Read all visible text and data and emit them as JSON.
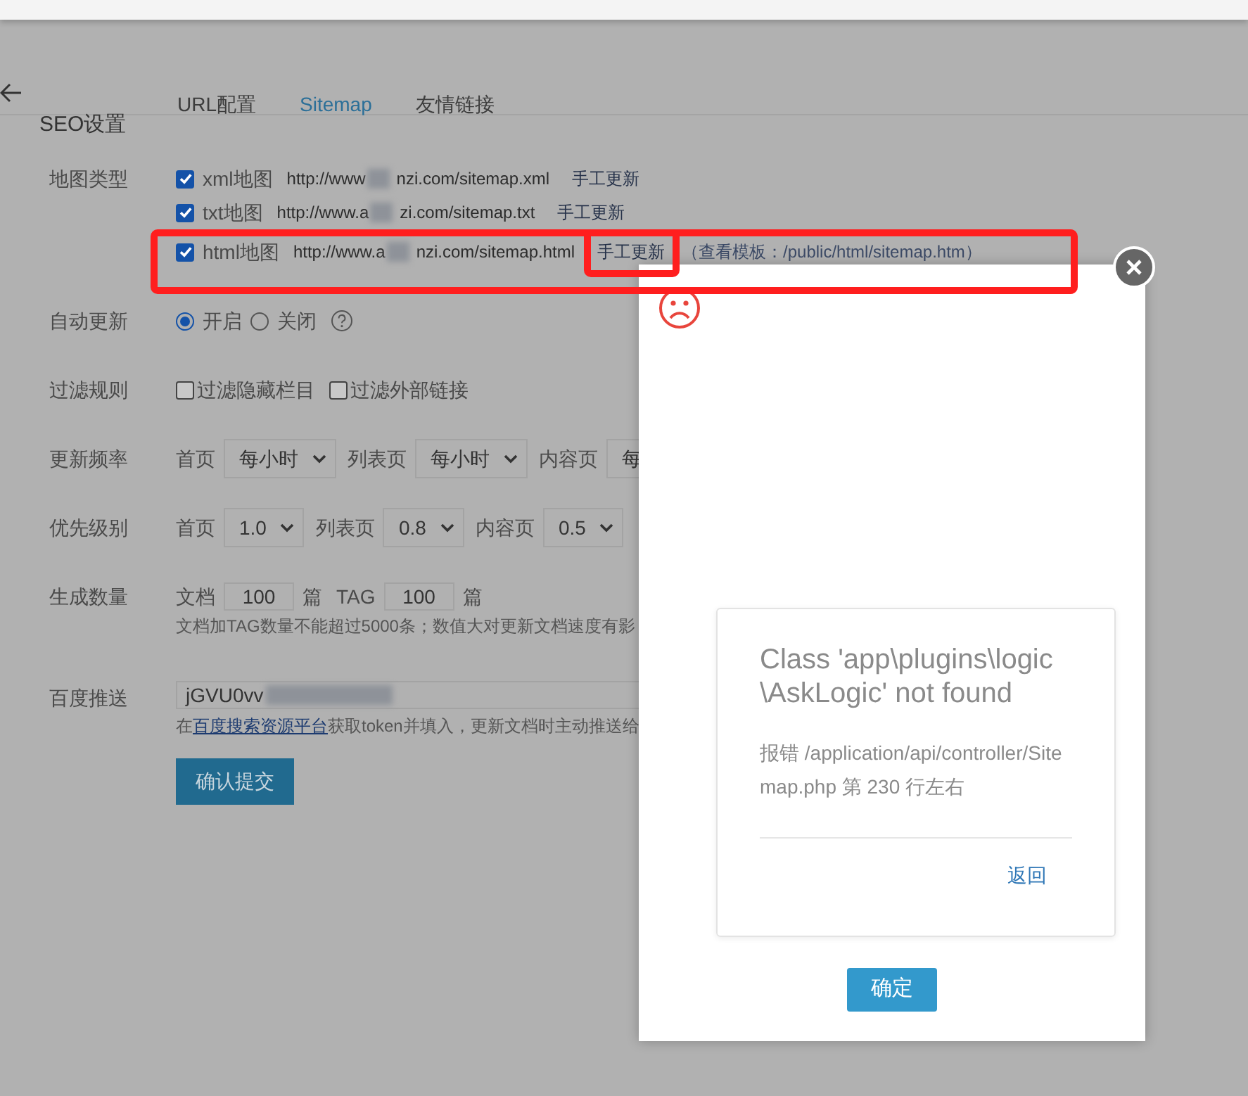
{
  "header": {
    "title": "SEO设置",
    "tabs": [
      {
        "label": "URL配置",
        "selected": false
      },
      {
        "label": "Sitemap",
        "selected": true
      },
      {
        "label": "友情链接",
        "selected": false
      }
    ]
  },
  "map_types": {
    "label": "地图类型",
    "items": [
      {
        "checked": true,
        "name": "xml地图",
        "url_start": "http://www",
        "url_end": "nzi.com/sitemap.xml",
        "action": "手工更新"
      },
      {
        "checked": true,
        "name": "txt地图",
        "url_start": "http://www.a",
        "url_end": "zi.com/sitemap.txt",
        "action": "手工更新"
      },
      {
        "checked": true,
        "name": "html地图",
        "url_start": "http://www.a",
        "url_end": "nzi.com/sitemap.html",
        "action": "手工更新",
        "note": "（查看模板：/public/html/sitemap.htm）"
      }
    ]
  },
  "auto_update": {
    "label": "自动更新",
    "options": [
      {
        "label": "开启",
        "selected": true
      },
      {
        "label": "关闭",
        "selected": false
      }
    ]
  },
  "filter": {
    "label": "过滤规则",
    "options": [
      {
        "label": "过滤隐藏栏目",
        "checked": false
      },
      {
        "label": "过滤外部链接",
        "checked": false
      }
    ]
  },
  "frequency": {
    "label": "更新频率",
    "selects": [
      {
        "label": "首页",
        "value": "每小时"
      },
      {
        "label": "列表页",
        "value": "每小时"
      },
      {
        "label": "内容页",
        "value": "每",
        "partial": true
      }
    ]
  },
  "priority": {
    "label": "优先级别",
    "selects": [
      {
        "label": "首页",
        "value": "1.0"
      },
      {
        "label": "列表页",
        "value": "0.8"
      },
      {
        "label": "内容页",
        "value": "0.5"
      }
    ]
  },
  "count": {
    "label": "生成数量",
    "fields": [
      {
        "label": "文档",
        "value": "100",
        "unit": "篇"
      },
      {
        "label": "TAG",
        "value": "100",
        "unit": "篇"
      }
    ],
    "help": "文档加TAG数量不能超过5000条；数值大对更新文档速度有影"
  },
  "baidu": {
    "label": "百度推送",
    "value": "jGVU0vv",
    "help_before": "在",
    "help_link": "百度搜索资源平台",
    "help_after": "获取token并填入，更新文档时主动推送给"
  },
  "submit": "确认提交",
  "dialog": {
    "title": "Class 'app\\plugins\\logic\\AskLogic' not found",
    "message": "报错 /application/api/controller/Sitemap.php 第 230 行左右",
    "back": "返回",
    "ok": "确定"
  }
}
